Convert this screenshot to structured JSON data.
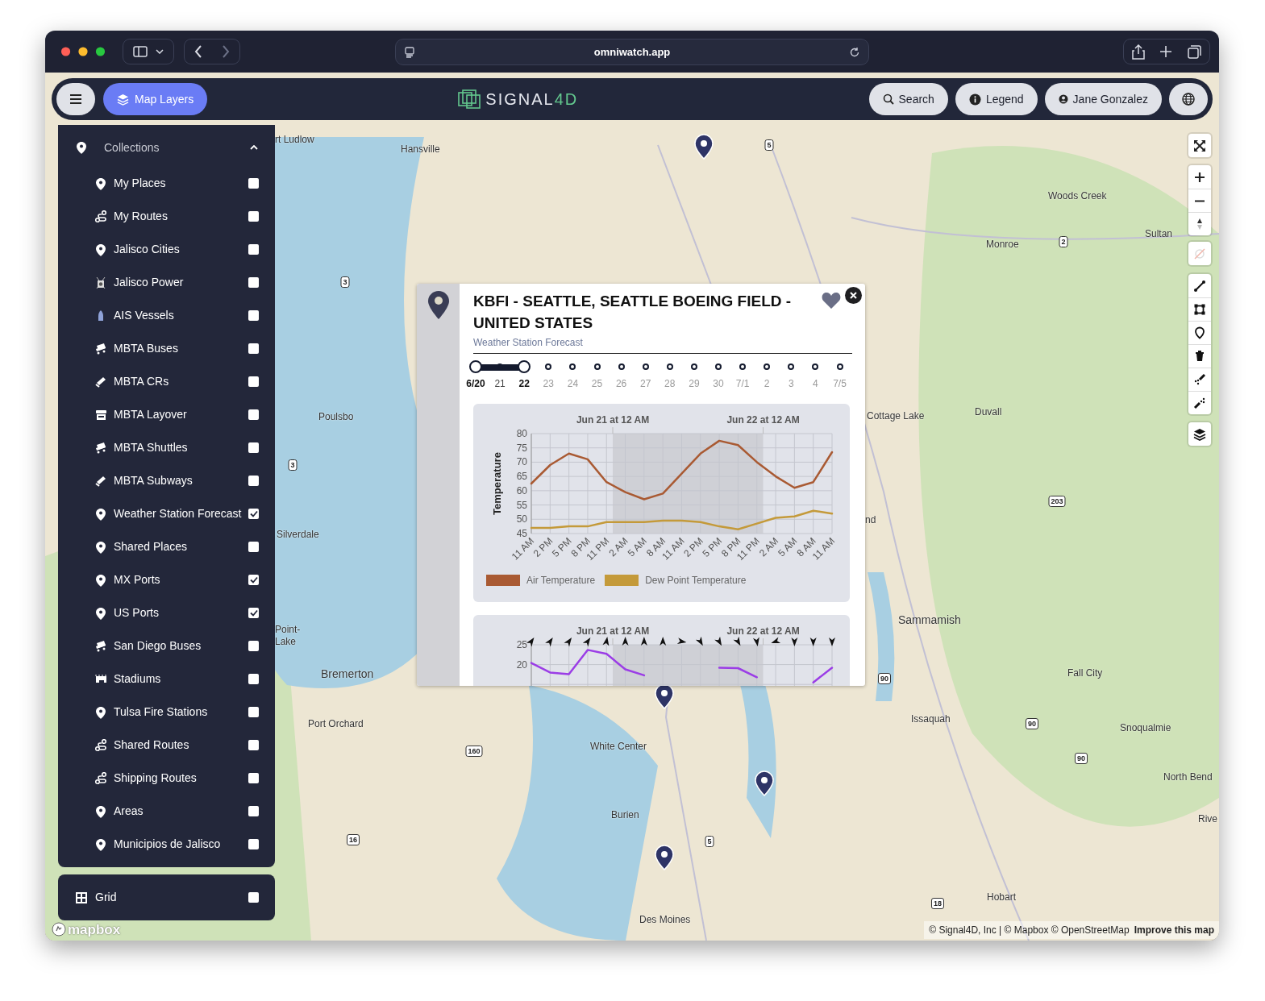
{
  "browser": {
    "url": "omniwatch.app"
  },
  "header": {
    "layers_button": "Map Layers",
    "logo": {
      "word": "SIGNAL",
      "suffix": "4D"
    },
    "buttons": [
      {
        "kind": "search",
        "label": "Search"
      },
      {
        "kind": "info",
        "label": "Legend"
      },
      {
        "kind": "user",
        "label": "Jane Gonzalez"
      }
    ]
  },
  "sidebar": {
    "title": "Collections",
    "expanded": true,
    "items": [
      {
        "kind": "pin",
        "label": "My Places",
        "checked": false
      },
      {
        "kind": "route",
        "label": "My Routes",
        "checked": false
      },
      {
        "kind": "pin",
        "label": "Jalisco Cities",
        "checked": false
      },
      {
        "kind": "power",
        "label": "Jalisco Power",
        "checked": false
      },
      {
        "kind": "vessel",
        "label": "AIS Vessels",
        "checked": false
      },
      {
        "kind": "bus",
        "label": "MBTA Buses",
        "checked": false
      },
      {
        "kind": "train",
        "label": "MBTA CRs",
        "checked": false
      },
      {
        "kind": "layover",
        "label": "MBTA Layover",
        "checked": false
      },
      {
        "kind": "bus",
        "label": "MBTA Shuttles",
        "checked": false
      },
      {
        "kind": "train",
        "label": "MBTA Subways",
        "checked": false
      },
      {
        "kind": "pin",
        "label": "Weather Station Forecast",
        "checked": true
      },
      {
        "kind": "pin",
        "label": "Shared Places",
        "checked": false
      },
      {
        "kind": "pin",
        "label": "MX Ports",
        "checked": true
      },
      {
        "kind": "pin",
        "label": "US Ports",
        "checked": true
      },
      {
        "kind": "bus",
        "label": "San Diego Buses",
        "checked": false
      },
      {
        "kind": "stadium",
        "label": "Stadiums",
        "checked": false
      },
      {
        "kind": "pin",
        "label": "Tulsa Fire Stations",
        "checked": false
      },
      {
        "kind": "route",
        "label": "Shared Routes",
        "checked": false
      },
      {
        "kind": "route",
        "label": "Shipping Routes",
        "checked": false
      },
      {
        "kind": "pin",
        "label": "Areas",
        "checked": false
      },
      {
        "kind": "pin",
        "label": "Municipios de Jalisco",
        "checked": false
      }
    ]
  },
  "grid_panel": {
    "label": "Grid",
    "checked": false
  },
  "popup": {
    "title": "KBFI - SEATTLE, SEATTLE BOEING FIELD - UNITED STATES",
    "subtitle": "Weather Station Forecast",
    "days": [
      {
        "label": "6/20",
        "in_range": true,
        "endpoint": true
      },
      {
        "label": "21",
        "in_range": true,
        "endpoint": false
      },
      {
        "label": "22",
        "in_range": true,
        "endpoint": true
      },
      {
        "label": "23",
        "in_range": false,
        "endpoint": false
      },
      {
        "label": "24",
        "in_range": false,
        "endpoint": false
      },
      {
        "label": "25",
        "in_range": false,
        "endpoint": false
      },
      {
        "label": "26",
        "in_range": false,
        "endpoint": false
      },
      {
        "label": "27",
        "in_range": false,
        "endpoint": false
      },
      {
        "label": "28",
        "in_range": false,
        "endpoint": false
      },
      {
        "label": "29",
        "in_range": false,
        "endpoint": false
      },
      {
        "label": "30",
        "in_range": false,
        "endpoint": false
      },
      {
        "label": "7/1",
        "in_range": false,
        "endpoint": false
      },
      {
        "label": "2",
        "in_range": false,
        "endpoint": false
      },
      {
        "label": "3",
        "in_range": false,
        "endpoint": false
      },
      {
        "label": "4",
        "in_range": false,
        "endpoint": false
      },
      {
        "label": "7/5",
        "in_range": false,
        "endpoint": false
      }
    ],
    "charts": [
      {
        "date_markers": [
          "Jun 21 at 12 AM",
          "Jun 22 at 12 AM"
        ],
        "chart_data": {
          "type": "line",
          "ylabel": "Temperature",
          "grid": true,
          "categories": [
            "11 AM",
            "2 PM",
            "5 PM",
            "8 PM",
            "11 PM",
            "2 AM",
            "5 AM",
            "8 AM",
            "11 AM",
            "2 PM",
            "5 PM",
            "8 PM",
            "11 PM",
            "2 AM",
            "5 AM",
            "8 AM",
            "11 AM"
          ],
          "ylim": [
            45,
            80
          ],
          "yticks": [
            45,
            50,
            55,
            60,
            65,
            70,
            75,
            80
          ],
          "series": [
            {
              "name": "Air Temperature",
              "color": "#a95a33",
              "values": [
                62.5,
                69,
                73,
                71,
                63,
                59.5,
                57,
                59,
                66,
                73,
                77.5,
                76,
                70,
                65,
                61,
                63,
                73.5
              ]
            },
            {
              "name": "Dew Point Temperature",
              "color": "#c49a3a",
              "values": [
                47,
                47,
                47.5,
                47.5,
                49,
                49,
                49,
                49.5,
                49.5,
                49,
                47.5,
                46.5,
                48.5,
                50.5,
                51,
                53,
                52
              ]
            }
          ]
        }
      },
      {
        "date_markers": [
          "Jun 21 at 12 AM",
          "Jun 22 at 12 AM"
        ],
        "chart_data": {
          "type": "line",
          "grid": true,
          "categories": [
            null,
            null,
            null,
            null,
            null,
            null,
            null,
            null,
            null,
            null,
            null,
            null,
            null,
            null,
            null,
            null,
            null
          ],
          "ylim": [
            0,
            25
          ],
          "yticks": [
            20,
            25
          ],
          "series": [
            {
              "color": "#9b3de6",
              "values": [
                20.4,
                18,
                17.6,
                23.7,
                22.7,
                18.8,
                17.3,
                null,
                null,
                null,
                19.2,
                19.1,
                16.8,
                null,
                null,
                15.5,
                19.2
              ]
            }
          ]
        }
      }
    ]
  },
  "map": {
    "places": [
      "rt Ludlow",
      "Hansville",
      "Woods Creek",
      "Monroe",
      "Sultan",
      "Poulsbo",
      "Cottage Lake",
      "Duvall",
      "Silverdale",
      "nd",
      "Sammamish",
      "Point-",
      "Lake",
      "Bremerton",
      "Fall City",
      "Port Orchard",
      "Issaquah",
      "Snoqualmie",
      "White Center",
      "North Bend",
      "Burien",
      "Rive",
      "Hobart",
      "Des Moines"
    ],
    "road_shields": [
      "5",
      "3",
      "2",
      "3",
      "203",
      "90",
      "90",
      "90",
      "160",
      "16",
      "5",
      "18"
    ],
    "logo": "mapbox",
    "attribution": "© Signal4D, Inc | © Mapbox © OpenStreetMap",
    "improve_link": "Improve this map"
  }
}
